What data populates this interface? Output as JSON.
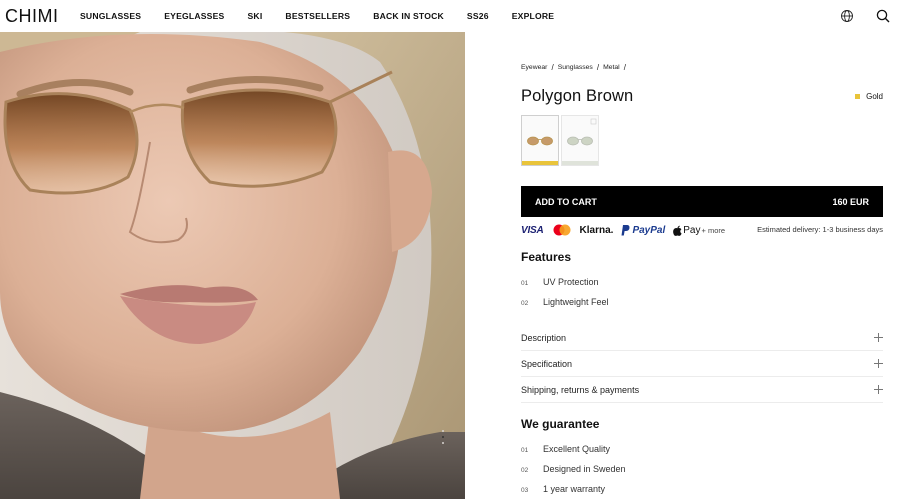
{
  "header": {
    "logo": "CHIMI",
    "nav": [
      "SUNGLASSES",
      "EYEGLASSES",
      "SKI",
      "BESTSELLERS",
      "BACK IN STOCK",
      "SS26",
      "EXPLORE"
    ],
    "icons": [
      "globe-icon",
      "search-icon"
    ]
  },
  "hero": {
    "image": "portrait-woman-wearing-gold-metal-sunglasses-brown-gradient-lenses"
  },
  "product": {
    "breadcrumb": [
      "Eyewear",
      "Sunglasses",
      "Metal"
    ],
    "breadcrumb_sep": "/",
    "title": "Polygon Brown",
    "color_name": "Gold",
    "color_swatch": "#e9c43a",
    "variants": [
      {
        "name": "gold-brown",
        "bar_color": "#e9c43a",
        "selected": true
      },
      {
        "name": "silver-green",
        "bar_color": "#dfe3da",
        "selected": false
      }
    ],
    "cart_label": "ADD TO CART",
    "price": "160 EUR"
  },
  "payments": {
    "visa": "VISA",
    "klarna": "Klarna.",
    "paypal": "PayPal",
    "applepay": "Pay",
    "more": "+ more",
    "delivery": "Estimated delivery: 1-3 business days"
  },
  "features": {
    "title": "Features",
    "items": [
      {
        "num": "01",
        "label": "UV Protection"
      },
      {
        "num": "02",
        "label": "Lightweight Feel"
      }
    ]
  },
  "accordions": [
    "Description",
    "Specification",
    "Shipping, returns & payments"
  ],
  "guarantee": {
    "title": "We guarantee",
    "items": [
      {
        "num": "01",
        "label": "Excellent Quality"
      },
      {
        "num": "02",
        "label": "Designed in Sweden"
      },
      {
        "num": "03",
        "label": "1 year warranty"
      }
    ]
  },
  "colors": {
    "primary_button": "#000000",
    "accent_gold": "#e9c43a"
  }
}
